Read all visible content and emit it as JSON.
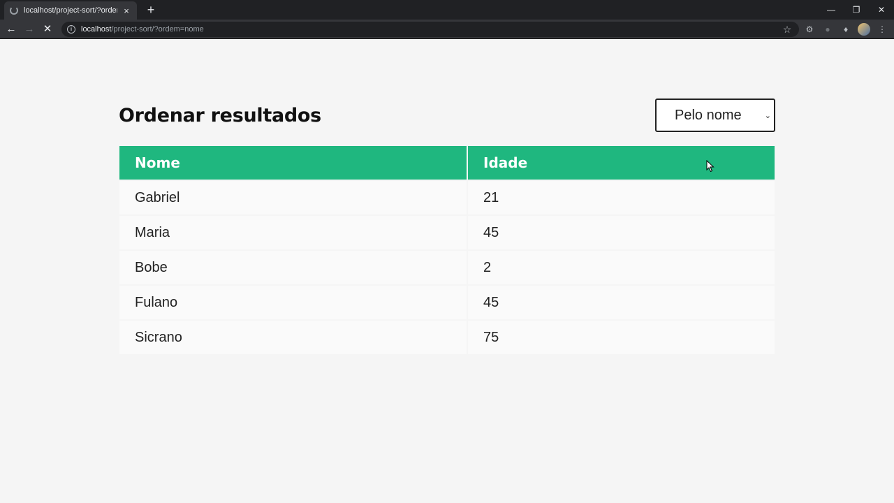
{
  "browser": {
    "tab_title": "localhost/project-sort/?ordem=n",
    "tab_close": "×",
    "new_tab": "+",
    "url_host": "localhost",
    "url_path": "/project-sort/?ordem=nome",
    "icons": [
      "loading-spinner-icon",
      "close-icon",
      "plus-icon",
      "back-arrow-icon",
      "forward-arrow-icon",
      "stop-icon",
      "info-icon",
      "star-icon",
      "gear-icon",
      "puzzle-icon",
      "avatar"
    ]
  },
  "page": {
    "title": "Ordenar resultados",
    "sort_select": {
      "selected": "Pelo nome"
    },
    "table": {
      "headers": [
        "Nome",
        "Idade"
      ],
      "rows": [
        {
          "nome": "Gabriel",
          "idade": "21"
        },
        {
          "nome": "Maria",
          "idade": "45"
        },
        {
          "nome": "Bobe",
          "idade": "2"
        },
        {
          "nome": "Fulano",
          "idade": "45"
        },
        {
          "nome": "Sicrano",
          "idade": "75"
        }
      ]
    }
  },
  "colors": {
    "header_green": "#1fb77f",
    "page_background": "#f5f5f5",
    "text": "#222222"
  }
}
